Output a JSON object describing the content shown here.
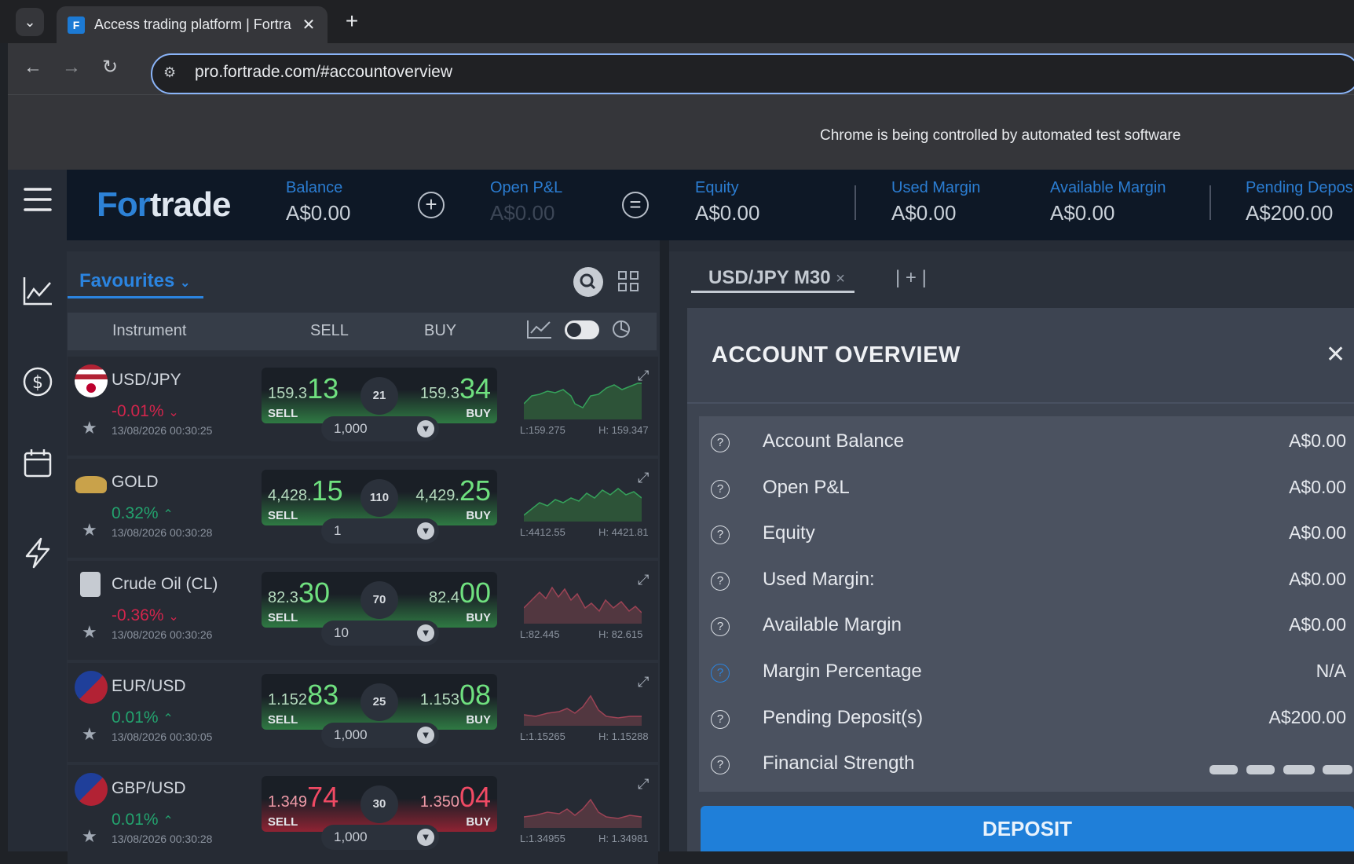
{
  "browser": {
    "tab_title": "Access trading platform | Fortra",
    "tab_close": "✕",
    "new_tab": "+",
    "url": "pro.fortrade.com/#accountoverview",
    "infobar": "Chrome is being controlled by automated test software"
  },
  "header": {
    "logo": "Fortrade",
    "metrics": [
      {
        "label": "Balance",
        "value": "A$0.00"
      },
      {
        "label": "Open P&L",
        "value": "A$0.00"
      },
      {
        "label": "Equity",
        "value": "A$0.00"
      },
      {
        "label": "Used Margin",
        "value": "A$0.00"
      },
      {
        "label": "Available Margin",
        "value": "A$0.00"
      },
      {
        "label": "Pending Depos",
        "value": "A$200.00"
      }
    ],
    "plus_icon": "+",
    "equals_icon": "="
  },
  "watchlist": {
    "title": "Favourites",
    "columns": {
      "instrument": "Instrument",
      "sell": "SELL",
      "buy": "BUY"
    },
    "rows": [
      {
        "name": "USD/JPY",
        "change": "-0.01%",
        "direction": "down",
        "time": "13/08/2026 00:30:25",
        "sell_prefix": "159.3",
        "sell_big": "13",
        "buy_prefix": "159.3",
        "buy_big": "34",
        "spread": "21",
        "qty": "1,000",
        "low": "L:159.275",
        "high": "H: 159.347",
        "color": "green",
        "sell_tag": "SELL",
        "buy_tag": "BUY"
      },
      {
        "name": "GOLD",
        "change": "0.32%",
        "direction": "up",
        "time": "13/08/2026 00:30:28",
        "sell_prefix": "4,428.",
        "sell_big": "15",
        "buy_prefix": "4,429.",
        "buy_big": "25",
        "spread": "110",
        "qty": "1",
        "low": "L:4412.55",
        "high": "H: 4421.81",
        "color": "green",
        "sell_tag": "SELL",
        "buy_tag": "BUY"
      },
      {
        "name": "Crude Oil (CL)",
        "change": "-0.36%",
        "direction": "down",
        "time": "13/08/2026 00:30:26",
        "sell_prefix": "82.3",
        "sell_big": "30",
        "buy_prefix": "82.4",
        "buy_big": "00",
        "spread": "70",
        "qty": "10",
        "low": "L:82.445",
        "high": "H: 82.615",
        "color": "green",
        "sell_tag": "SELL",
        "buy_tag": "BUY"
      },
      {
        "name": "EUR/USD",
        "change": "0.01%",
        "direction": "up",
        "time": "13/08/2026 00:30:05",
        "sell_prefix": "1.152",
        "sell_big": "83",
        "buy_prefix": "1.153",
        "buy_big": "08",
        "spread": "25",
        "qty": "1,000",
        "low": "L:1.15265",
        "high": "H: 1.15288",
        "color": "green",
        "sell_tag": "SELL",
        "buy_tag": "BUY"
      },
      {
        "name": "GBP/USD",
        "change": "0.01%",
        "direction": "up",
        "time": "13/08/2026 00:30:28",
        "sell_prefix": "1.349",
        "sell_big": "74",
        "buy_prefix": "1.350",
        "buy_big": "04",
        "spread": "30",
        "qty": "1,000",
        "low": "L:1.34955",
        "high": "H: 1.34981",
        "color": "red",
        "sell_tag": "SELL",
        "buy_tag": "BUY"
      }
    ]
  },
  "chart_tab": {
    "label": "USD/JPY M30",
    "close": "×",
    "add": "+"
  },
  "account_overview": {
    "title": "ACCOUNT OVERVIEW",
    "items": [
      {
        "label": "Account Balance",
        "value": "A$0.00"
      },
      {
        "label": "Open P&L",
        "value": "A$0.00"
      },
      {
        "label": "Equity",
        "value": "A$0.00"
      },
      {
        "label": "Used Margin:",
        "value": "A$0.00"
      },
      {
        "label": "Available Margin",
        "value": "A$0.00"
      },
      {
        "label": "Margin Percentage",
        "value": "N/A"
      },
      {
        "label": "Pending Deposit(s)",
        "value": "A$200.00"
      },
      {
        "label": "Financial Strength",
        "value": ""
      }
    ],
    "deposit_label": "DEPOSIT"
  },
  "colors": {
    "accent": "#2b84e0",
    "sell_green": "#2f7a43",
    "sell_red": "#8f2333",
    "positive": "#23a36e",
    "negative": "#d2254c"
  }
}
